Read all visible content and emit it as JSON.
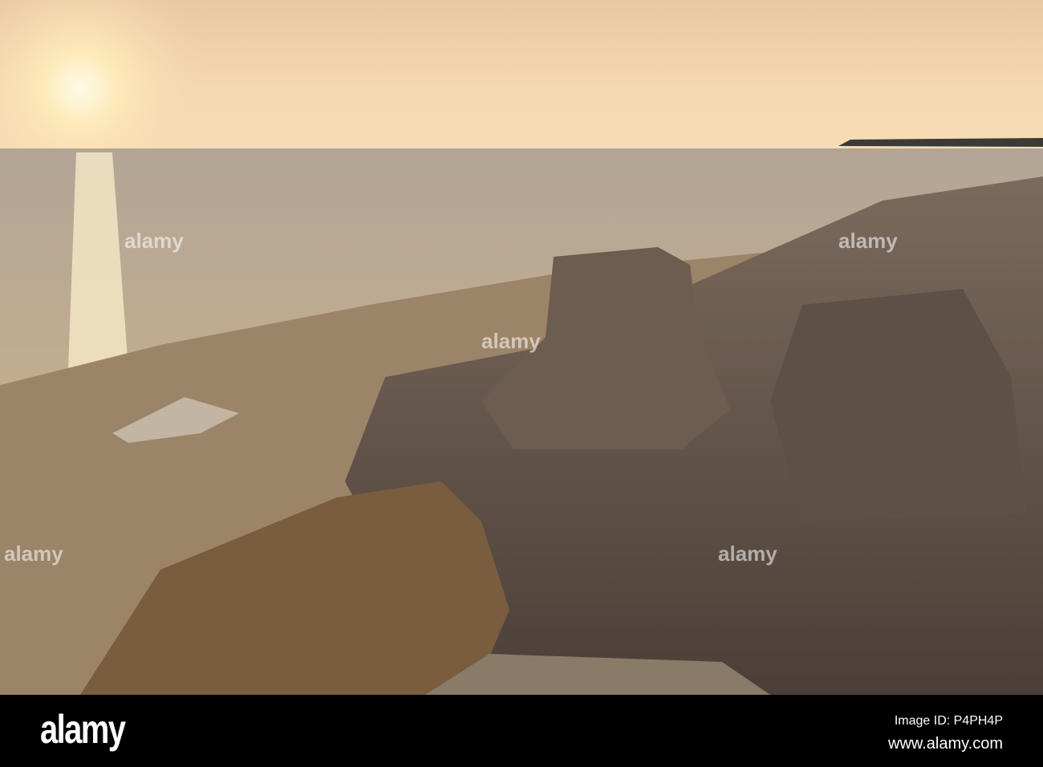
{
  "footer": {
    "logo": "alamy",
    "image_id": "Image ID: P4PH4P",
    "site": "www.alamy.com"
  },
  "watermark": "alamy"
}
